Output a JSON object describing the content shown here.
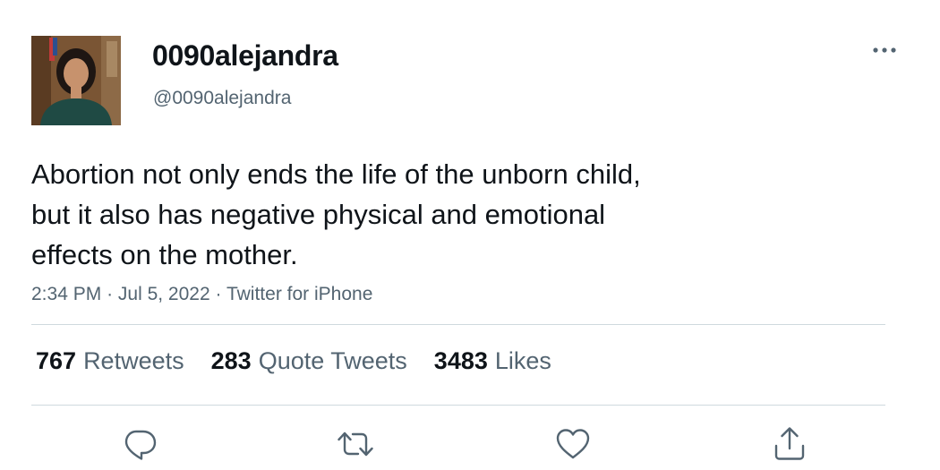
{
  "user": {
    "display_name": "0090alejandra",
    "handle": "@0090alejandra",
    "avatar_icon": "profile-photo"
  },
  "tweet": {
    "lines": [
      "Abortion not only ends the life of the unborn child,",
      "but it also has negative physical and emotional",
      "effects on the mother."
    ],
    "time": "2:34 PM",
    "separator": "·",
    "date": "Jul 5, 2022",
    "source": "Twitter for iPhone"
  },
  "stats": {
    "retweets": {
      "count": "767",
      "label": "Retweets"
    },
    "quotes": {
      "count": "283",
      "label": "Quote Tweets"
    },
    "likes": {
      "count": "3483",
      "label": "Likes"
    }
  },
  "actions": {
    "reply_icon": "reply-icon",
    "retweet_icon": "retweet-icon",
    "like_icon": "heart-icon",
    "share_icon": "share-icon",
    "more_icon": "more-horizontal-icon"
  },
  "colors": {
    "text": "#0f1419",
    "secondary": "#536471",
    "divider": "#cfd9de"
  }
}
